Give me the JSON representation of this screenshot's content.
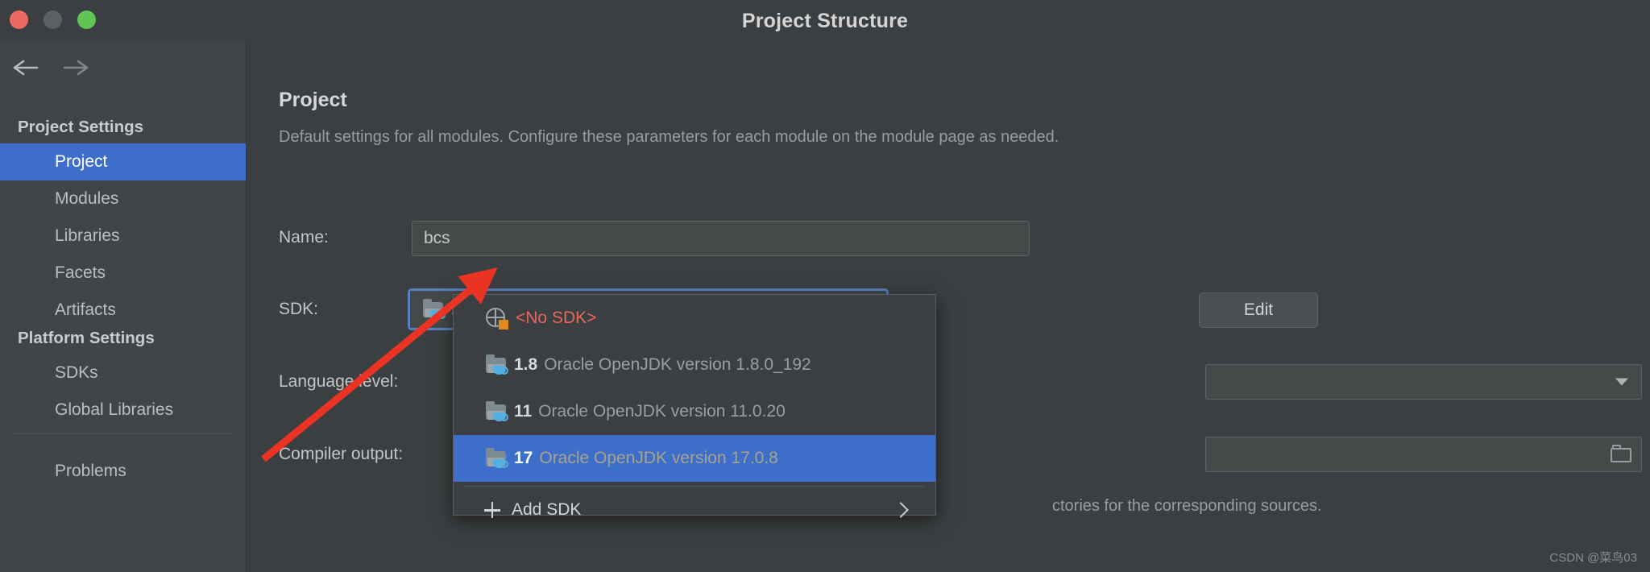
{
  "window": {
    "title": "Project Structure",
    "traffic_lights": [
      "close-red",
      "minimize-gray",
      "zoom-green"
    ]
  },
  "sidebar": {
    "nav": {
      "back_icon": "arrow-left-icon",
      "forward_icon": "arrow-right-icon"
    },
    "groups": [
      {
        "heading": "Project Settings",
        "items": [
          {
            "label": "Project",
            "selected": true
          },
          {
            "label": "Modules",
            "selected": false
          },
          {
            "label": "Libraries",
            "selected": false
          },
          {
            "label": "Facets",
            "selected": false
          },
          {
            "label": "Artifacts",
            "selected": false
          }
        ]
      },
      {
        "heading": "Platform Settings",
        "items": [
          {
            "label": "SDKs",
            "selected": false
          },
          {
            "label": "Global Libraries",
            "selected": false
          }
        ]
      }
    ],
    "footer_items": [
      {
        "label": "Problems",
        "selected": false
      }
    ]
  },
  "main": {
    "section_title": "Project",
    "section_desc": "Default settings for all modules. Configure these parameters for each module on the module page as needed.",
    "fields": {
      "name": {
        "label": "Name:",
        "value": "bcs"
      },
      "sdk": {
        "label": "SDK:",
        "version": "17",
        "description": "Oracle OpenJDK version 17.0.8",
        "icon": "jdk-folder-icon",
        "caret_icon": "caret-down-icon",
        "focused": true
      },
      "language_level": {
        "label": "Language level:",
        "value": "",
        "caret_icon": "caret-down-icon"
      },
      "compiler_output": {
        "label": "Compiler output:",
        "value": "",
        "browse_icon": "folder-icon"
      }
    },
    "edit_button": "Edit",
    "hint_text": "ctories for the corresponding sources."
  },
  "sdk_dropdown": {
    "items": [
      {
        "icon": "no-sdk-globe-icon",
        "version": "<No SDK>",
        "description": "",
        "kind": "none",
        "highlighted": false
      },
      {
        "icon": "jdk-folder-icon",
        "version": "1.8",
        "description": "Oracle OpenJDK version 1.8.0_192",
        "kind": "jdk",
        "highlighted": false
      },
      {
        "icon": "jdk-folder-icon",
        "version": "11",
        "description": "Oracle OpenJDK version 11.0.20",
        "kind": "jdk",
        "highlighted": false
      },
      {
        "icon": "jdk-folder-icon",
        "version": "17",
        "description": "Oracle OpenJDK version 17.0.8",
        "kind": "jdk",
        "highlighted": true
      }
    ],
    "add_sdk": {
      "label": "Add SDK",
      "plus_icon": "plus-icon",
      "submenu_icon": "chevron-right-icon"
    }
  },
  "annotation": {
    "arrow_color": "#ea3323",
    "type": "arrow-pointing-to-sdk-icon"
  },
  "watermark": "CSDN @菜鸟03",
  "colors": {
    "accent": "#3c6eca",
    "window_bg": "#3c3f41",
    "sidebar_bg": "#41454a",
    "field_bg": "#45494a",
    "focus_border": "#5980c4",
    "error_text": "#e8685e"
  }
}
